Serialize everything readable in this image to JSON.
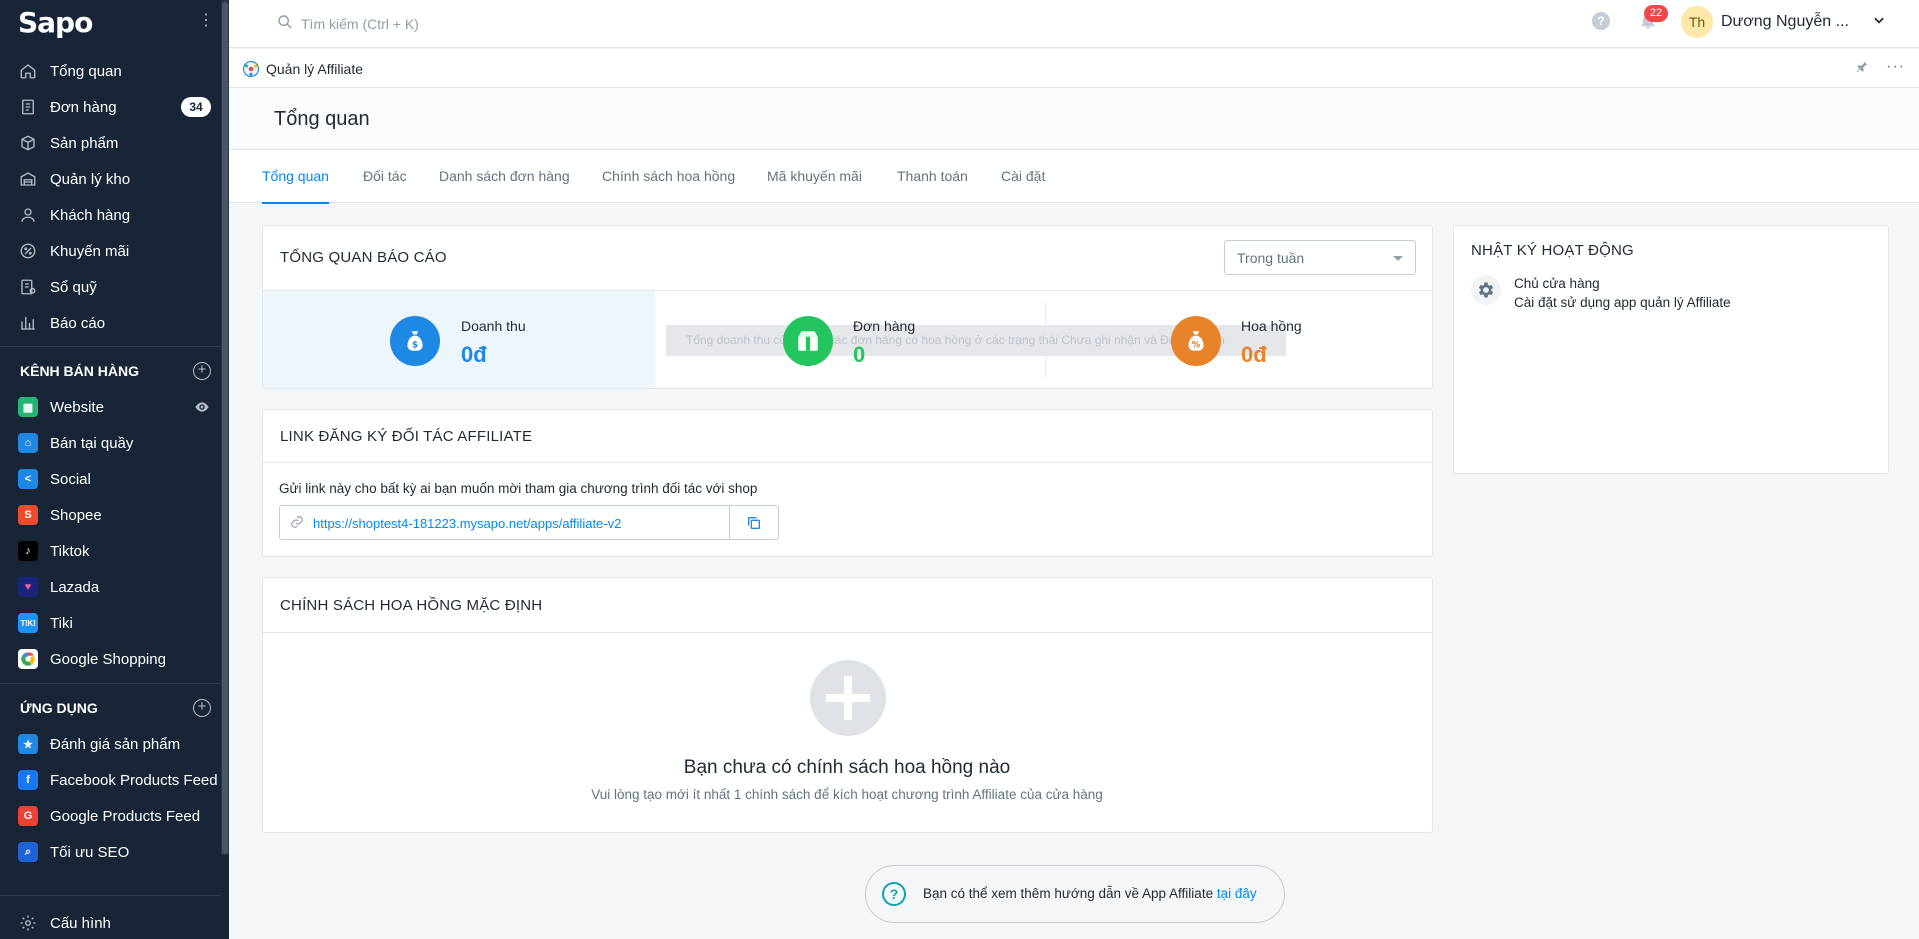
{
  "sidebar": {
    "logo": "Sapo",
    "nav": [
      {
        "label": "Tổng quan",
        "icon": "home-icon"
      },
      {
        "label": "Đơn hàng",
        "icon": "order-icon",
        "badge": "34"
      },
      {
        "label": "Sản phẩm",
        "icon": "box-icon"
      },
      {
        "label": "Quản lý kho",
        "icon": "warehouse-icon"
      },
      {
        "label": "Khách hàng",
        "icon": "user-icon"
      },
      {
        "label": "Khuyến mãi",
        "icon": "discount-icon"
      },
      {
        "label": "Sổ quỹ",
        "icon": "cashbook-icon"
      },
      {
        "label": "Báo cáo",
        "icon": "report-icon"
      }
    ],
    "channels_header": "KÊNH BÁN HÀNG",
    "channels": [
      {
        "label": "Website",
        "icon": "website-icon",
        "color": "#22b573"
      },
      {
        "label": "Bán tại quầy",
        "icon": "pos-icon",
        "color": "#1e88e5"
      },
      {
        "label": "Social",
        "icon": "social-icon",
        "color": "#1e88e5"
      },
      {
        "label": "Shopee",
        "icon": "shopee-icon",
        "color": "#ee4d2d"
      },
      {
        "label": "Tiktok",
        "icon": "tiktok-icon",
        "color": "#000000"
      },
      {
        "label": "Lazada",
        "icon": "lazada-icon",
        "color": "#1a237e"
      },
      {
        "label": "Tiki",
        "icon": "tiki-icon",
        "color": "#1a94ff"
      },
      {
        "label": "Google Shopping",
        "icon": "google-shopping-icon",
        "color": "#ffffff"
      }
    ],
    "apps_header": "ỨNG DỤNG",
    "apps": [
      {
        "label": "Đánh giá sản phẩm",
        "icon": "star-icon",
        "color": "#1e88e5"
      },
      {
        "label": "Facebook Products Feed",
        "icon": "facebook-icon",
        "color": "#1877f2"
      },
      {
        "label": "Google Products Feed",
        "icon": "google-icon",
        "color": "#ea4335"
      },
      {
        "label": "Tối ưu SEO",
        "icon": "seo-icon",
        "color": "#1e63d8"
      }
    ],
    "settings": "Cấu hình"
  },
  "topbar": {
    "search_placeholder": "Tìm kiếm (Ctrl + K)",
    "notif_count": "22",
    "avatar_initials": "Th",
    "user_name": "Dương Nguyễn ..."
  },
  "app_header": {
    "title": "Quản lý Affiliate"
  },
  "page_title": "Tổng quan",
  "tabs": [
    "Tổng quan",
    "Đối tác",
    "Danh sách đơn hàng",
    "Chính sách hoa hồng",
    "Mã khuyến mãi",
    "Thanh toán",
    "Cài đặt"
  ],
  "report": {
    "title": "TỔNG QUAN BÁO CÁO",
    "period": "Trong tuần",
    "stats": [
      {
        "label": "Doanh thu",
        "value": "0đ",
        "color": "#1e88e5"
      },
      {
        "label": "Đơn hàng",
        "value": "0",
        "color": "#22c55e"
      },
      {
        "label": "Hoa hồng",
        "value": "0đ",
        "color": "#e8832a"
      }
    ],
    "tooltip": "Tổng doanh thu của tất cả các đơn hàng có hoa hồng ở các trạng thái Chưa ghi nhận và Đã ghi nhận"
  },
  "link_card": {
    "title": "LINK ĐĂNG KÝ ĐỐI TÁC AFFILIATE",
    "description": "Gửi link này cho bất kỳ ai bạn muốn mời tham gia chương trình đối tác với shop",
    "url": "https://shoptest4-181223.mysapo.net/apps/affiliate-v2"
  },
  "policy_card": {
    "title": "CHÍNH SÁCH HOA HỒNG MẶC ĐỊNH",
    "empty_title": "Bạn chưa có chính sách hoa hồng nào",
    "empty_sub": "Vui lòng tạo mới ít nhất 1 chính sách để kích hoạt chương trình Affiliate của cửa hàng"
  },
  "activity": {
    "title": "NHẬT KÝ HOẠT ĐỘNG",
    "entries": [
      {
        "actor": "Chủ cửa hàng",
        "action": "Cài đặt sử dụng app quản lý Affiliate"
      }
    ]
  },
  "help": {
    "text": "Bạn có thể xem thêm hướng dẫn về App Affiliate ",
    "link": "tại đây"
  }
}
